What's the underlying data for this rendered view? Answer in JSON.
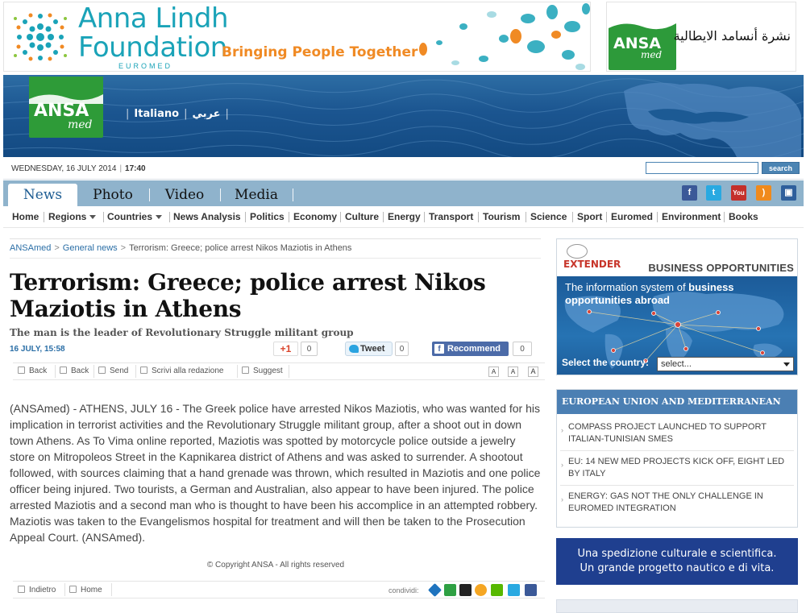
{
  "banners": {
    "alf": {
      "title_line1": "Anna Lindh",
      "title_line2": "Foundation",
      "subtitle": "EUROMED",
      "tagline": "Bringing People Together"
    },
    "ansamed": {
      "logo_word": "ANSA",
      "logo_sub": "med",
      "arabic_title": "نشرة أنسامد الايطالية"
    }
  },
  "header": {
    "logo_word": "ANSA",
    "logo_sub": "med",
    "lang_italiano": "Italiano",
    "lang_arabic": "عربي",
    "sep": "|"
  },
  "datebar": {
    "date": "WEDNESDAY, 16 JULY 2014",
    "sep": "|",
    "time": "17:40",
    "search_button": "search",
    "search_value": ""
  },
  "tabs": [
    {
      "label": "News",
      "active": true
    },
    {
      "label": "Photo",
      "active": false
    },
    {
      "label": "Video",
      "active": false
    },
    {
      "label": "Media",
      "active": false
    }
  ],
  "social": [
    {
      "icon": "facebook-icon",
      "glyph": "f",
      "color": "#3b5998"
    },
    {
      "icon": "twitter-icon",
      "glyph": "t",
      "color": "#29a9e1"
    },
    {
      "icon": "youtube-icon",
      "glyph": "You",
      "color": "#c4302b"
    },
    {
      "icon": "rss-icon",
      "glyph": ")",
      "color": "#f08a1c"
    },
    {
      "icon": "mobile-icon",
      "glyph": "▣",
      "color": "#2e5f9c"
    }
  ],
  "categories": {
    "items": [
      "Home",
      "Regions",
      "Countries",
      "News Analysis",
      "Politics",
      "Economy",
      "Culture",
      "Energy",
      "Transport",
      "Tourism",
      "Science",
      "Sport",
      "Euromed",
      "Environment",
      "Books"
    ]
  },
  "breadcrumb": {
    "root": "ANSAmed",
    "section": "General news",
    "current": "Terrorism: Greece; police arrest Nikos Maziotis in Athens",
    "gt": ">"
  },
  "article": {
    "title": "Terrorism: Greece; police arrest Nikos Maziotis in Athens",
    "subtitle": "The man is the leader of Revolutionary Struggle militant group",
    "date": "16 JULY, 15:58",
    "gplus_label": "+1",
    "gplus_count": "0",
    "tweet_label": "Tweet",
    "tweet_count": "0",
    "fb_label": "Recommend",
    "fb_count": "0",
    "body": "(ANSAmed) - ATHENS, JULY 16 - The Greek police have arrested Nikos Maziotis, who was wanted for his implication in terrorist activities and the Revolutionary Struggle militant group, after a shoot out in down town Athens. As To Vima online reported, Maziotis was spotted by motorcycle police outside a jewelry store on Mitropoleos Street in the Kapnikarea district of Athens and was asked to surrender. A shootout followed, with sources claiming that a hand grenade was thrown, which resulted in Maziotis and one police officer being injured. Two tourists, a German and Australian, also appear to have been injured. The police arrested Maziotis and a second man who is thought to have been his accomplice in an attempted robbery. Maziotis was taken to the Evangelismos hospital for treatment and will then be taken to the Prosecution Appeal Court. (ANSAmed).",
    "copyright": "© Copyright ANSA - All rights reserved"
  },
  "toolbar": {
    "back1": "Back",
    "back2": "Back",
    "send": "Send",
    "write": "Scrivi alla redazione",
    "suggest": "Suggest",
    "font_a": "A"
  },
  "bottombar": {
    "back": "Indietro",
    "home": "Home",
    "share_label": "condividi:"
  },
  "sidebar": {
    "business": {
      "brand": "EXTENDER",
      "title": "BUSINESS OPPORTUNITIES",
      "desc_plain": "The information system of ",
      "desc_bold": "business opportunities abroad",
      "country_label": "Select the country:",
      "select_value": "select..."
    },
    "eu": {
      "title": "EUROPEAN UNION AND MEDITERRANEAN",
      "items": [
        "COMPASS PROJECT LAUNCHED TO SUPPORT ITALIAN-TUNISIAN SMES",
        "EU: 14 NEW MED PROJECTS KICK OFF, EIGHT LED BY ITALY",
        "ENERGY: GAS NOT THE ONLY CHALLENGE IN EUROMED INTEGRATION"
      ]
    },
    "promo": {
      "line1": "Una spedizione culturale e scientifica.",
      "line2": "Un grande progetto nautico e di vita."
    }
  },
  "colors": {
    "accent_blue": "#2a6ea6",
    "tab_bar": "#8fb3cc",
    "ansa_green": "#2e9b38",
    "eu_head": "#4b7fb3",
    "promo_bg": "#1f3f8f"
  }
}
